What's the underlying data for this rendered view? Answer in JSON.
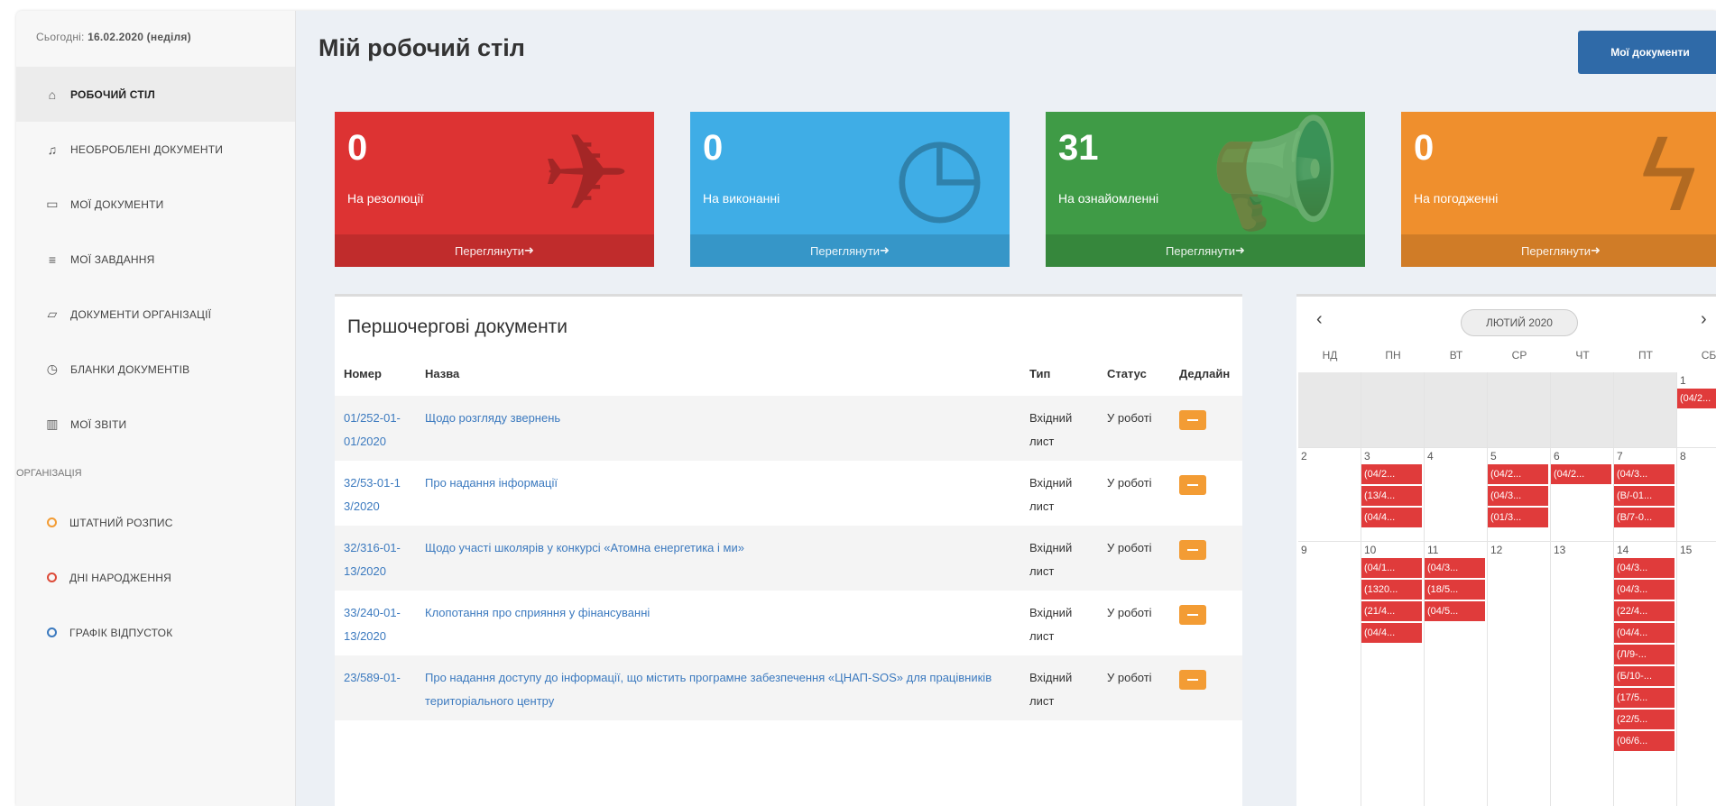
{
  "sidebar": {
    "today_label": "Сьогодні:",
    "today_date": "16.02.2020 (неділя)",
    "items": [
      {
        "icon": "home-icon",
        "glyph": "⌂",
        "label": "Робочий стіл",
        "active": true
      },
      {
        "icon": "bell-icon",
        "glyph": "♫",
        "label": "Необроблені документи"
      },
      {
        "icon": "folder-icon",
        "glyph": "▭",
        "label": "Мої документи"
      },
      {
        "icon": "tasks-icon",
        "glyph": "≡",
        "label": "Мої завдання"
      },
      {
        "icon": "folder-open-icon",
        "glyph": "▱",
        "label": "Документи організації"
      },
      {
        "icon": "copy-icon",
        "glyph": "◷",
        "label": "Бланки документів"
      },
      {
        "icon": "chart-icon",
        "glyph": "▥",
        "label": "Мої звіти"
      }
    ],
    "section_label": "Організація",
    "org_items": [
      {
        "label": "Штатний розпис",
        "color": "#f39c34"
      },
      {
        "label": "Дні народження",
        "color": "#dd4b39"
      },
      {
        "label": "Графік відпусток",
        "color": "#3c7abf"
      }
    ]
  },
  "header": {
    "title": "Мій робочий стіл",
    "my_docs_button": "Мої документи"
  },
  "stats": [
    {
      "value": "0",
      "label": "На резолюції",
      "footer": "Переглянути",
      "color": "#dd3333",
      "icon": "paper-plane-icon",
      "glyph": "✈"
    },
    {
      "value": "0",
      "label": "На виконанні",
      "footer": "Переглянути",
      "color": "#3fade6",
      "icon": "clock-icon",
      "glyph": "◷"
    },
    {
      "value": "31",
      "label": "На ознайомленні",
      "footer": "Переглянути",
      "color": "#3f9b46",
      "icon": "bullhorn-icon",
      "glyph": "📢"
    },
    {
      "value": "0",
      "label": "На погодженні",
      "footer": "Переглянути",
      "color": "#ef8f2d",
      "icon": "bolt-icon",
      "glyph": "ϟ"
    }
  ],
  "priority": {
    "title": "Першочергові документи",
    "columns": [
      "Номер",
      "Назва",
      "Тип",
      "Статус",
      "Дедлайн"
    ],
    "rows": [
      {
        "number": "01/252-01-01/2020",
        "name": "Щодо розгляду звернень",
        "type": "Вхідний лист",
        "status": "У роботі"
      },
      {
        "number": "32/53-01-13/2020",
        "name": "Про надання інформації",
        "type": "Вхідний лист",
        "status": "У роботі"
      },
      {
        "number": "32/316-01-13/2020",
        "name": "Щодо участі школярів у конкурсі «Атомна енергетика і ми»",
        "type": "Вхідний лист",
        "status": "У роботі"
      },
      {
        "number": "33/240-01-13/2020",
        "name": "Клопотання про сприяння у фінансуванні",
        "type": "Вхідний лист",
        "status": "У роботі"
      },
      {
        "number": "23/589-01-",
        "name": "Про надання доступу до інформації, що містить програмне забезпечення «ЦНАП-SOS» для працівників територіального центру",
        "type": "Вхідний лист",
        "status": "У роботі"
      }
    ]
  },
  "calendar": {
    "month_label": "ЛЮТИЙ 2020",
    "prev": "‹",
    "next": "›",
    "weekdays": [
      "НД",
      "ПН",
      "ВТ",
      "СР",
      "ЧТ",
      "ПТ",
      "СБ"
    ],
    "weeks": [
      [
        {
          "day": "",
          "muted": true,
          "events": []
        },
        {
          "day": "",
          "muted": true,
          "events": []
        },
        {
          "day": "",
          "muted": true,
          "events": []
        },
        {
          "day": "",
          "muted": true,
          "events": []
        },
        {
          "day": "",
          "muted": true,
          "events": []
        },
        {
          "day": "",
          "muted": true,
          "events": []
        },
        {
          "day": "1",
          "events": [
            "(04/2..."
          ]
        }
      ],
      [
        {
          "day": "2",
          "events": []
        },
        {
          "day": "3",
          "events": [
            "(04/2...",
            "(13/4...",
            "(04/4..."
          ]
        },
        {
          "day": "4",
          "events": []
        },
        {
          "day": "5",
          "events": [
            "(04/2...",
            "(04/3...",
            "(01/3..."
          ]
        },
        {
          "day": "6",
          "events": [
            "(04/2..."
          ]
        },
        {
          "day": "7",
          "events": [
            "(04/3...",
            "(В/-01...",
            "(В/7-0..."
          ]
        },
        {
          "day": "8",
          "events": []
        }
      ],
      [
        {
          "day": "9",
          "events": []
        },
        {
          "day": "10",
          "events": [
            "(04/1...",
            "(1320...",
            "(21/4...",
            "(04/4..."
          ]
        },
        {
          "day": "11",
          "events": [
            "(04/3...",
            "(18/5...",
            "(04/5..."
          ]
        },
        {
          "day": "12",
          "events": []
        },
        {
          "day": "13",
          "events": []
        },
        {
          "day": "14",
          "events": [
            "(04/3...",
            "(04/3...",
            "(22/4...",
            "(04/4...",
            "(Л/9-...",
            "(Б/10-...",
            "(17/5...",
            "(22/5...",
            "(06/6..."
          ]
        },
        {
          "day": "15",
          "events": []
        }
      ]
    ]
  }
}
